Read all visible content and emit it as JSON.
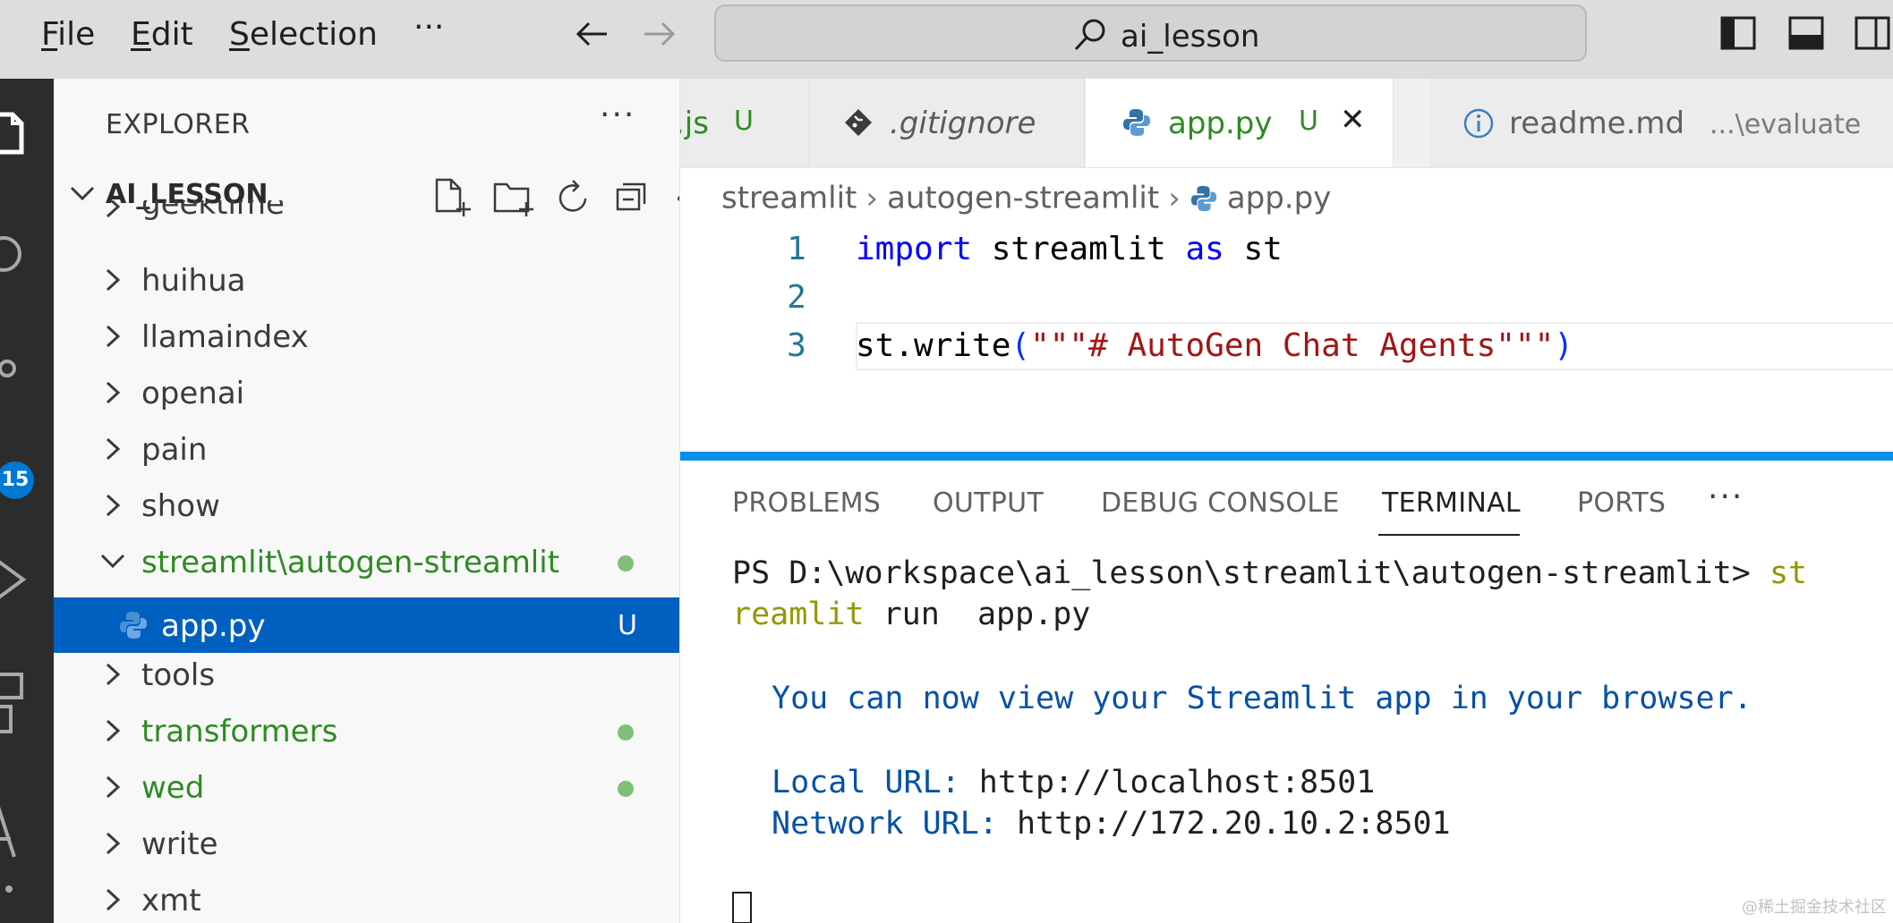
{
  "menu": {
    "file": "File",
    "file_key": "F",
    "edit": "Edit",
    "edit_key": "E",
    "selection": "Selection",
    "selection_key": "S",
    "more": "···"
  },
  "search": {
    "text": "ai_lesson"
  },
  "activity": {
    "scm_badge": "15"
  },
  "explorer": {
    "title": "EXPLORER",
    "more": "···",
    "root_label": "AI_LESSON",
    "items": [
      {
        "label": "geektime"
      },
      {
        "label": "huihua"
      },
      {
        "label": "llamaindex"
      },
      {
        "label": "openai"
      },
      {
        "label": "pain"
      },
      {
        "label": "show"
      },
      {
        "label": "streamlit\\autogen-streamlit"
      },
      {
        "label": "app.py",
        "status": "U"
      },
      {
        "label": "tools"
      },
      {
        "label": "transformers"
      },
      {
        "label": "wed"
      },
      {
        "label": "write"
      },
      {
        "label": "xmt"
      }
    ]
  },
  "tabs": [
    {
      "label": ".js",
      "status": "U"
    },
    {
      "label": ".gitignore"
    },
    {
      "label": "app.py",
      "status": "U",
      "close": "✕"
    },
    {
      "label": "readme.md",
      "desc": "...\\evaluate"
    }
  ],
  "breadcrumb": {
    "seg1": "streamlit",
    "seg2": "autogen-streamlit",
    "seg3": "app.py",
    "sep": "›"
  },
  "editor": {
    "lines": [
      {
        "no": "1",
        "kw": "import",
        "mid": " streamlit ",
        "kw2": "as",
        "tail": " st"
      },
      {
        "no": "2"
      },
      {
        "no": "3",
        "pre": "st.write",
        "open": "(",
        "str": "\"\"\"# AutoGen Chat Agents\"\"\"",
        "close": ")"
      }
    ]
  },
  "panel": {
    "tabs": [
      "PROBLEMS",
      "OUTPUT",
      "DEBUG CONSOLE",
      "TERMINAL",
      "PORTS"
    ],
    "more": "···",
    "terminal": {
      "prompt": "PS D:\\workspace\\ai_lesson\\streamlit\\autogen-streamlit> ",
      "cmd_start": "st",
      "cmd_rest": "reamlit",
      "args": " run  app.py",
      "view_msg": "You can now view your Streamlit app in your browser.",
      "local_label": "Local URL: ",
      "local_url": "http://localhost:8501",
      "network_label": "Network URL: ",
      "network_url": "http://172.20.10.2:8501"
    }
  },
  "watermark": "@稀土掘金技术社区",
  "colors": {
    "accent": "#0078d4",
    "selection": "#0060c0",
    "git_untracked": "#2e8b24"
  }
}
